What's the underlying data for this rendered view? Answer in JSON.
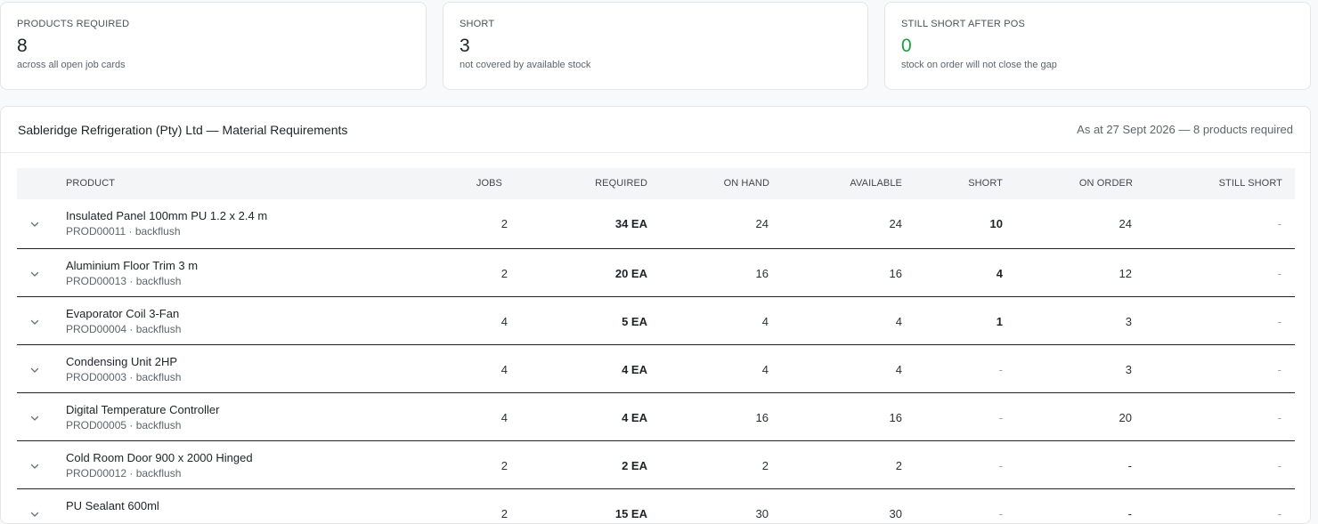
{
  "stats": [
    {
      "label": "PRODUCTS REQUIRED",
      "value": "8",
      "sub": "across all open job cards"
    },
    {
      "label": "SHORT",
      "value": "3",
      "sub": "not covered by available stock"
    },
    {
      "label": "STILL SHORT AFTER POS",
      "value": "0",
      "sub": "stock on order will not close the gap"
    }
  ],
  "panel": {
    "title": "Sableridge Refrigeration (Pty) Ltd — Material Requirements",
    "meta": "As at 27 Sept 2026 — 8 products required"
  },
  "table": {
    "headers": {
      "product": "PRODUCT",
      "jobs": "JOBS",
      "required": "REQUIRED",
      "on_hand": "ON HAND",
      "available": "AVAILABLE",
      "short": "SHORT",
      "on_order": "ON ORDER",
      "still_short": "STILL SHORT"
    },
    "rows": [
      {
        "name": "Insulated Panel 100mm PU 1.2 x 2.4 m",
        "code": "PROD00011 · backflush",
        "jobs": "2",
        "required": "34 EA",
        "on_hand": "24",
        "available": "24",
        "short": "10",
        "on_order": "24",
        "still_short": "-"
      },
      {
        "name": "Aluminium Floor Trim 3 m",
        "code": "PROD00013 · backflush",
        "jobs": "2",
        "required": "20 EA",
        "on_hand": "16",
        "available": "16",
        "short": "4",
        "on_order": "12",
        "still_short": "-"
      },
      {
        "name": "Evaporator Coil 3-Fan",
        "code": "PROD00004 · backflush",
        "jobs": "4",
        "required": "5 EA",
        "on_hand": "4",
        "available": "4",
        "short": "1",
        "on_order": "3",
        "still_short": "-"
      },
      {
        "name": "Condensing Unit 2HP",
        "code": "PROD00003 · backflush",
        "jobs": "4",
        "required": "4 EA",
        "on_hand": "4",
        "available": "4",
        "short": "-",
        "on_order": "3",
        "still_short": "-"
      },
      {
        "name": "Digital Temperature Controller",
        "code": "PROD00005 · backflush",
        "jobs": "4",
        "required": "4 EA",
        "on_hand": "16",
        "available": "16",
        "short": "-",
        "on_order": "20",
        "still_short": "-"
      },
      {
        "name": "Cold Room Door 900 x 2000 Hinged",
        "code": "PROD00012 · backflush",
        "jobs": "2",
        "required": "2 EA",
        "on_hand": "2",
        "available": "2",
        "short": "-",
        "on_order": "-",
        "still_short": "-"
      },
      {
        "name": "PU Sealant 600ml",
        "code": "",
        "jobs": "2",
        "required": "15 EA",
        "on_hand": "30",
        "available": "30",
        "short": "-",
        "on_order": "-",
        "still_short": "-"
      }
    ]
  },
  "icons": {
    "expand": "chevron-down-icon"
  },
  "colors": {
    "positive": "#1e9e3f",
    "text": "#1f2328",
    "muted": "#5f656b"
  }
}
